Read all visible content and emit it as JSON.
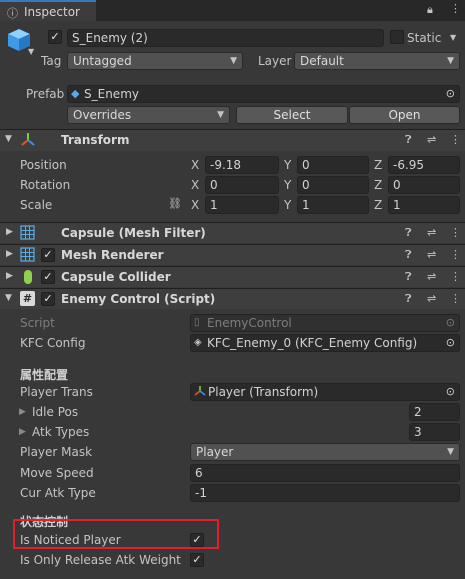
{
  "tab": {
    "title": "Inspector"
  },
  "object": {
    "name": "S_Enemy (2)",
    "static_label": "Static",
    "tag_label": "Tag",
    "tag_value": "Untagged",
    "layer_label": "Layer",
    "layer_value": "Default"
  },
  "prefab": {
    "label": "Prefab",
    "value": "S_Enemy",
    "overrides": "Overrides",
    "select": "Select",
    "open": "Open"
  },
  "transform": {
    "title": "Transform",
    "position": {
      "label": "Position",
      "x": "-9.18",
      "y": "0",
      "z": "-6.95"
    },
    "rotation": {
      "label": "Rotation",
      "x": "0",
      "y": "0",
      "z": "0"
    },
    "scale": {
      "label": "Scale",
      "x": "1",
      "y": "1",
      "z": "1"
    },
    "axis": {
      "x": "X",
      "y": "Y",
      "z": "Z"
    }
  },
  "components": {
    "mesh_filter": "Capsule (Mesh Filter)",
    "mesh_renderer": "Mesh Renderer",
    "capsule_collider": "Capsule Collider",
    "enemy_control": "Enemy Control (Script)"
  },
  "script": {
    "script_label": "Script",
    "script_value": "EnemyControl",
    "kfc_label": "KFC Config",
    "kfc_value": "KFC_Enemy_0 (KFC_Enemy Config)",
    "section1": "属性配置",
    "player_trans_label": "Player Trans",
    "player_trans_value": "Player (Transform)",
    "idle_pos_label": "Idle Pos",
    "idle_pos_value": "2",
    "atk_types_label": "Atk Types",
    "atk_types_value": "3",
    "player_mask_label": "Player Mask",
    "player_mask_value": "Player",
    "move_speed_label": "Move Speed",
    "move_speed_value": "6",
    "cur_atk_label": "Cur Atk Type",
    "cur_atk_value": "-1",
    "section2": "状态控制",
    "noticed_label": "Is Noticed Player",
    "only_release_label": "Is Only Release Atk Weight"
  },
  "colors": {
    "highlight": "#e0202a",
    "tab_accent": "#3a79bb"
  }
}
